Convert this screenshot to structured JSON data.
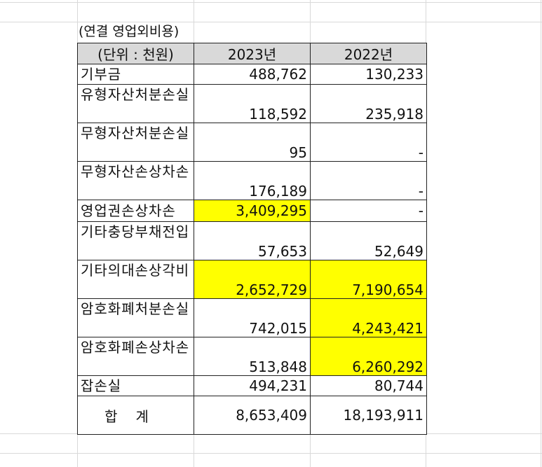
{
  "caption": "(연결 영업외비용)",
  "header": {
    "unit_label": "(단위 : 천원)",
    "col_2023": "2023년",
    "col_2022": "2022년"
  },
  "rows": [
    {
      "label": "기부금",
      "v2023": "488,762",
      "v2022": "130,233",
      "hl2023": false,
      "hl2022": false
    },
    {
      "label": "유형자산처분손실",
      "v2023": "118,592",
      "v2022": "235,918",
      "hl2023": false,
      "hl2022": false
    },
    {
      "label": "무형자산처분손실",
      "v2023": "95",
      "v2022": "-",
      "hl2023": false,
      "hl2022": false
    },
    {
      "label": "무형자산손상차손",
      "v2023": "176,189",
      "v2022": "-",
      "hl2023": false,
      "hl2022": false
    },
    {
      "label": "영업권손상차손",
      "v2023": "3,409,295",
      "v2022": "-",
      "hl2023": true,
      "hl2022": false
    },
    {
      "label": "기타충당부채전입",
      "v2023": "57,653",
      "v2022": "52,649",
      "hl2023": false,
      "hl2022": false
    },
    {
      "label": "기타의대손상각비",
      "v2023": "2,652,729",
      "v2022": "7,190,654",
      "hl2023": true,
      "hl2022": true
    },
    {
      "label": "암호화폐처분손실",
      "v2023": "742,015",
      "v2022": "4,243,421",
      "hl2023": false,
      "hl2022": true
    },
    {
      "label": "암호화폐손상차손",
      "v2023": "513,848",
      "v2022": "6,260,292",
      "hl2023": false,
      "hl2022": true
    },
    {
      "label": "잡손실",
      "v2023": "494,231",
      "v2022": "80,744",
      "hl2023": false,
      "hl2022": false
    }
  ],
  "total": {
    "label": "합계",
    "v2023": "8,653,409",
    "v2022": "18,193,911"
  },
  "colors": {
    "highlight": "#ffff00",
    "header_bg": "#d9d9d9",
    "gridline": "#d9d9d9"
  }
}
